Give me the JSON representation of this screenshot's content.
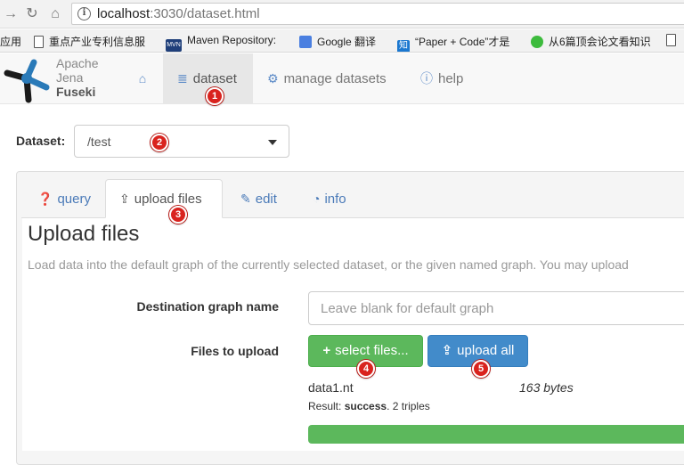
{
  "browser": {
    "url_host": "localhost",
    "url_rest": ":3030/dataset.html",
    "bookmarks": [
      "应用",
      "重点产业专利信息服",
      "Maven Repository:",
      "Google 翻译",
      "“Paper + Code”才是",
      "从6篇顶会论文看知识"
    ],
    "bookmark_badges": {
      "maven": "MVN",
      "zhihu": "知"
    }
  },
  "app": {
    "logo_line1": "Apache",
    "logo_line2": "Jena",
    "logo_line3": "Fuseki",
    "nav": {
      "home_icon": "home-icon",
      "dataset": "dataset",
      "manage": "manage datasets",
      "help": "help"
    }
  },
  "dataset": {
    "label": "Dataset:",
    "selected": "/test"
  },
  "tabs": {
    "query": "query",
    "upload": "upload files",
    "edit": "edit",
    "info": "info"
  },
  "upload": {
    "heading": "Upload files",
    "help": "Load data into the default graph of the currently selected dataset, or the given named graph. You may upload",
    "graph_label": "Destination graph name",
    "graph_placeholder": "Leave blank for default graph",
    "files_label": "Files to upload",
    "select_btn": "select files...",
    "upload_btn": "upload all",
    "file": {
      "name": "data1.nt",
      "size": "163 bytes",
      "result_prefix": "Result:",
      "result_status": "success",
      "result_suffix": ". 2 triples",
      "progress": 1.0
    }
  },
  "markers": [
    "1",
    "2",
    "3",
    "4",
    "5"
  ],
  "colors": {
    "marker": "#d9231e",
    "green": "#5cb85c",
    "blue": "#428bca",
    "link": "#4a7ab8"
  }
}
